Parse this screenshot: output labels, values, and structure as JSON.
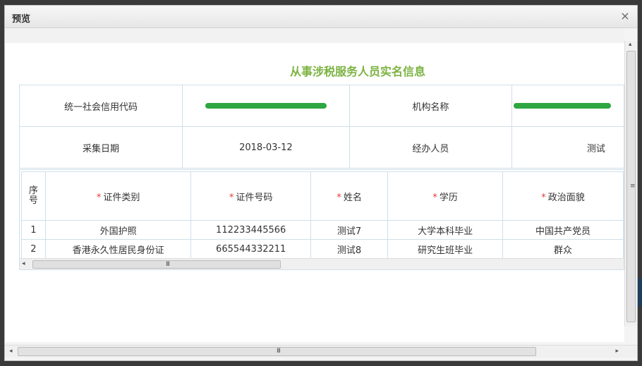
{
  "dialog": {
    "title": "预览",
    "close_icon": "×"
  },
  "form": {
    "heading": "从事涉税服务人员实名信息",
    "rows": [
      {
        "label1": "统一社会信用代码",
        "value1": "[redacted]",
        "label2": "机构名称",
        "value2": "[redacted]"
      },
      {
        "label1": "采集日期",
        "value1": "2018-03-12",
        "label2": "经办人员",
        "value2": "测试"
      }
    ]
  },
  "grid": {
    "columns": [
      "序号",
      "证件类别",
      "证件号码",
      "姓名",
      "学历",
      "政治面貌"
    ],
    "required_marker": "*",
    "rows": [
      {
        "index": "1",
        "id_type": "外国护照",
        "id_number": "112233445566",
        "name": "测试7",
        "education": "大学本科毕业",
        "political": "中国共产党员"
      },
      {
        "index": "2",
        "id_type": "香港永久性居民身份证",
        "id_number": "665544332211",
        "name": "测试8",
        "education": "研究生班毕业",
        "political": "群众"
      }
    ]
  },
  "scroll": {
    "left_arrow": "◂",
    "right_arrow": "▸",
    "up_arrow": "▴",
    "grip_h": "III",
    "grip_v": "≡"
  },
  "colors": {
    "heading": "#7cb342",
    "redaction": "#2ea641",
    "required": "#e53935",
    "border": "#cfe0ea"
  }
}
